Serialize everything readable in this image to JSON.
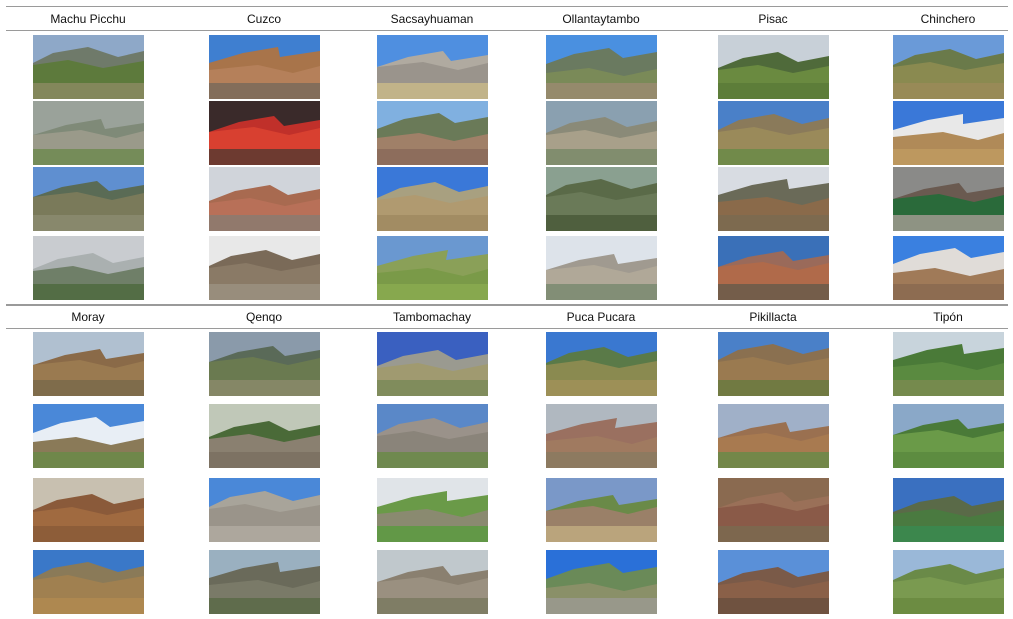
{
  "sections": [
    {
      "sites": [
        {
          "name": "Machu Picchu",
          "photos": [
            {
              "sky": "#8ea8c8",
              "far": "#6f7a6a",
              "near": "#5d7a3c",
              "ground": "#8a8a60"
            },
            {
              "sky": "#9aa29a",
              "far": "#7f8a78",
              "near": "#9a9a8a",
              "ground": "#6f8a50"
            },
            {
              "sky": "#5f8fd0",
              "far": "#5a6b55",
              "near": "#7a7a5a",
              "ground": "#8b8b70"
            },
            {
              "sky": "#c9ccd0",
              "far": "#aab0b0",
              "near": "#6f7f68",
              "ground": "#4f6a3f"
            }
          ]
        },
        {
          "name": "Cuzco",
          "photos": [
            {
              "sky": "#3f7fd0",
              "far": "#a8744a",
              "near": "#b5805a",
              "ground": "#7a6a5a"
            },
            {
              "sky": "#3a2a2a",
              "far": "#c0302a",
              "near": "#d84030",
              "ground": "#5a3a30"
            },
            {
              "sky": "#d0d4da",
              "far": "#a86a50",
              "near": "#b87058",
              "ground": "#8a7a70"
            },
            {
              "sky": "#e8e8e8",
              "far": "#7a6a58",
              "near": "#8a7a66",
              "ground": "#9a9080"
            }
          ]
        },
        {
          "name": "Sacsayhuaman",
          "photos": [
            {
              "sky": "#4f8fe0",
              "far": "#b0aaa0",
              "near": "#9a948c",
              "ground": "#c8b888"
            },
            {
              "sky": "#80b0e0",
              "far": "#6a7a58",
              "near": "#a08068",
              "ground": "#8a6a5a"
            },
            {
              "sky": "#3a78d8",
              "far": "#a8a080",
              "near": "#b09a70",
              "ground": "#a08a60"
            },
            {
              "sky": "#6a98d0",
              "far": "#8aa058",
              "near": "#7a9a48",
              "ground": "#8aaa50"
            }
          ]
        },
        {
          "name": "Ollantaytambo",
          "photos": [
            {
              "sky": "#4a90e0",
              "far": "#6a7a60",
              "near": "#7a8a58",
              "ground": "#9a8a70"
            },
            {
              "sky": "#8aa0b0",
              "far": "#8a8a78",
              "near": "#a8a08a",
              "ground": "#7a8a68"
            },
            {
              "sky": "#8aa090",
              "far": "#5a6a48",
              "near": "#6a7a58",
              "ground": "#4a5a3a"
            },
            {
              "sky": "#dde3ea",
              "far": "#a09a90",
              "near": "#b0a898",
              "ground": "#7a8a70"
            }
          ]
        },
        {
          "name": "Pisac",
          "photos": [
            {
              "sky": "#c8d0d8",
              "far": "#4f6a3a",
              "near": "#6a8a40",
              "ground": "#5a7a38"
            },
            {
              "sky": "#4a80c8",
              "far": "#8a7a5a",
              "near": "#9a8a5a",
              "ground": "#6a8a48"
            },
            {
              "sky": "#d8dce2",
              "far": "#6a6a58",
              "near": "#8a6a4a",
              "ground": "#7a6a50"
            },
            {
              "sky": "#3a70b8",
              "far": "#9a6a5a",
              "near": "#b06a4a",
              "ground": "#6a5a4a"
            }
          ]
        },
        {
          "name": "Chinchero",
          "photos": [
            {
              "sky": "#6a9ad8",
              "far": "#6a7a4a",
              "near": "#8a8a50",
              "ground": "#9a8a58"
            },
            {
              "sky": "#3a78d8",
              "far": "#e8e8e8",
              "near": "#b08a58",
              "ground": "#c09a60"
            },
            {
              "sky": "#8a8a88",
              "far": "#6a5a50",
              "near": "#2a6a3a",
              "ground": "#a09a90"
            },
            {
              "sky": "#3a80e0",
              "far": "#e0dcd8",
              "near": "#a07a58",
              "ground": "#8a6a50"
            }
          ]
        }
      ]
    },
    {
      "sites": [
        {
          "name": "Moray",
          "photos": [
            {
              "sky": "#b0c0d0",
              "far": "#8a6a48",
              "near": "#9a7a50",
              "ground": "#7a6a4a"
            },
            {
              "sky": "#4a88d8",
              "far": "#e8eef5",
              "near": "#8a7a58",
              "ground": "#6a8a48"
            },
            {
              "sky": "#c8c0b0",
              "far": "#8a5a3a",
              "near": "#a06a40",
              "ground": "#8a5a38"
            },
            {
              "sky": "#3a78c8",
              "far": "#8a7a58",
              "near": "#a08050",
              "ground": "#b08a50"
            }
          ]
        },
        {
          "name": "Qenqo",
          "photos": [
            {
              "sky": "#8a9aaa",
              "far": "#5a6a58",
              "near": "#6a7a50",
              "ground": "#8a8a6a"
            },
            {
              "sky": "#c0c8b8",
              "far": "#4a6a38",
              "near": "#8a8070",
              "ground": "#7a7060"
            },
            {
              "sky": "#4a88d8",
              "far": "#a8a49a",
              "near": "#9a948a",
              "ground": "#b0aaa0"
            },
            {
              "sky": "#9ab0c0",
              "far": "#6a6a5a",
              "near": "#7a7a68",
              "ground": "#5a6a48"
            }
          ]
        },
        {
          "name": "Tambomachay",
          "photos": [
            {
              "sky": "#3a60c0",
              "far": "#9a9a90",
              "near": "#a09a70",
              "ground": "#7a8a58"
            },
            {
              "sky": "#5a88c8",
              "far": "#9a928a",
              "near": "#8a847a",
              "ground": "#6a8a48"
            },
            {
              "sky": "#e0e4e8",
              "far": "#6a9a48",
              "near": "#8a8a70",
              "ground": "#5a9a40"
            },
            {
              "sky": "#c0c8cc",
              "far": "#8a8070",
              "near": "#9a9080",
              "ground": "#7a7a60"
            }
          ]
        },
        {
          "name": "Puca Pucara",
          "photos": [
            {
              "sky": "#3a78d0",
              "far": "#5a7a48",
              "near": "#8a8a50",
              "ground": "#a09058"
            },
            {
              "sky": "#b0b8c0",
              "far": "#9a7060",
              "near": "#a07a60",
              "ground": "#8a7a60"
            },
            {
              "sky": "#7a98c8",
              "far": "#6a8a48",
              "near": "#9a8068",
              "ground": "#c0aa80"
            },
            {
              "sky": "#2a70d8",
              "far": "#6a8a58",
              "near": "#8a9068",
              "ground": "#9a9a90"
            }
          ]
        },
        {
          "name": "Pikillacta",
          "photos": [
            {
              "sky": "#4a80c8",
              "far": "#8a7050",
              "near": "#9a7a50",
              "ground": "#6a7a40"
            },
            {
              "sky": "#a0b0c8",
              "far": "#9a7050",
              "near": "#a87a50",
              "ground": "#6a8a48"
            },
            {
              "sky": "#8a6a50",
              "far": "#9a7058",
              "near": "#8a5a48",
              "ground": "#7a6a50"
            },
            {
              "sky": "#5a90d8",
              "far": "#7a5a48",
              "near": "#8a6048",
              "ground": "#6a5040"
            }
          ]
        },
        {
          "name": "Tipón",
          "photos": [
            {
              "sky": "#c8d4dc",
              "far": "#4a7a38",
              "near": "#5a8a40",
              "ground": "#7a8a50"
            },
            {
              "sky": "#8aa8c8",
              "far": "#4a7a38",
              "near": "#6a9a48",
              "ground": "#5a8a40"
            },
            {
              "sky": "#3a70c0",
              "far": "#5a6a48",
              "near": "#4a7a40",
              "ground": "#3a8a50"
            },
            {
              "sky": "#9ab8d8",
              "far": "#6a8a48",
              "near": "#7a9a50",
              "ground": "#6a8a40"
            }
          ]
        }
      ]
    }
  ]
}
